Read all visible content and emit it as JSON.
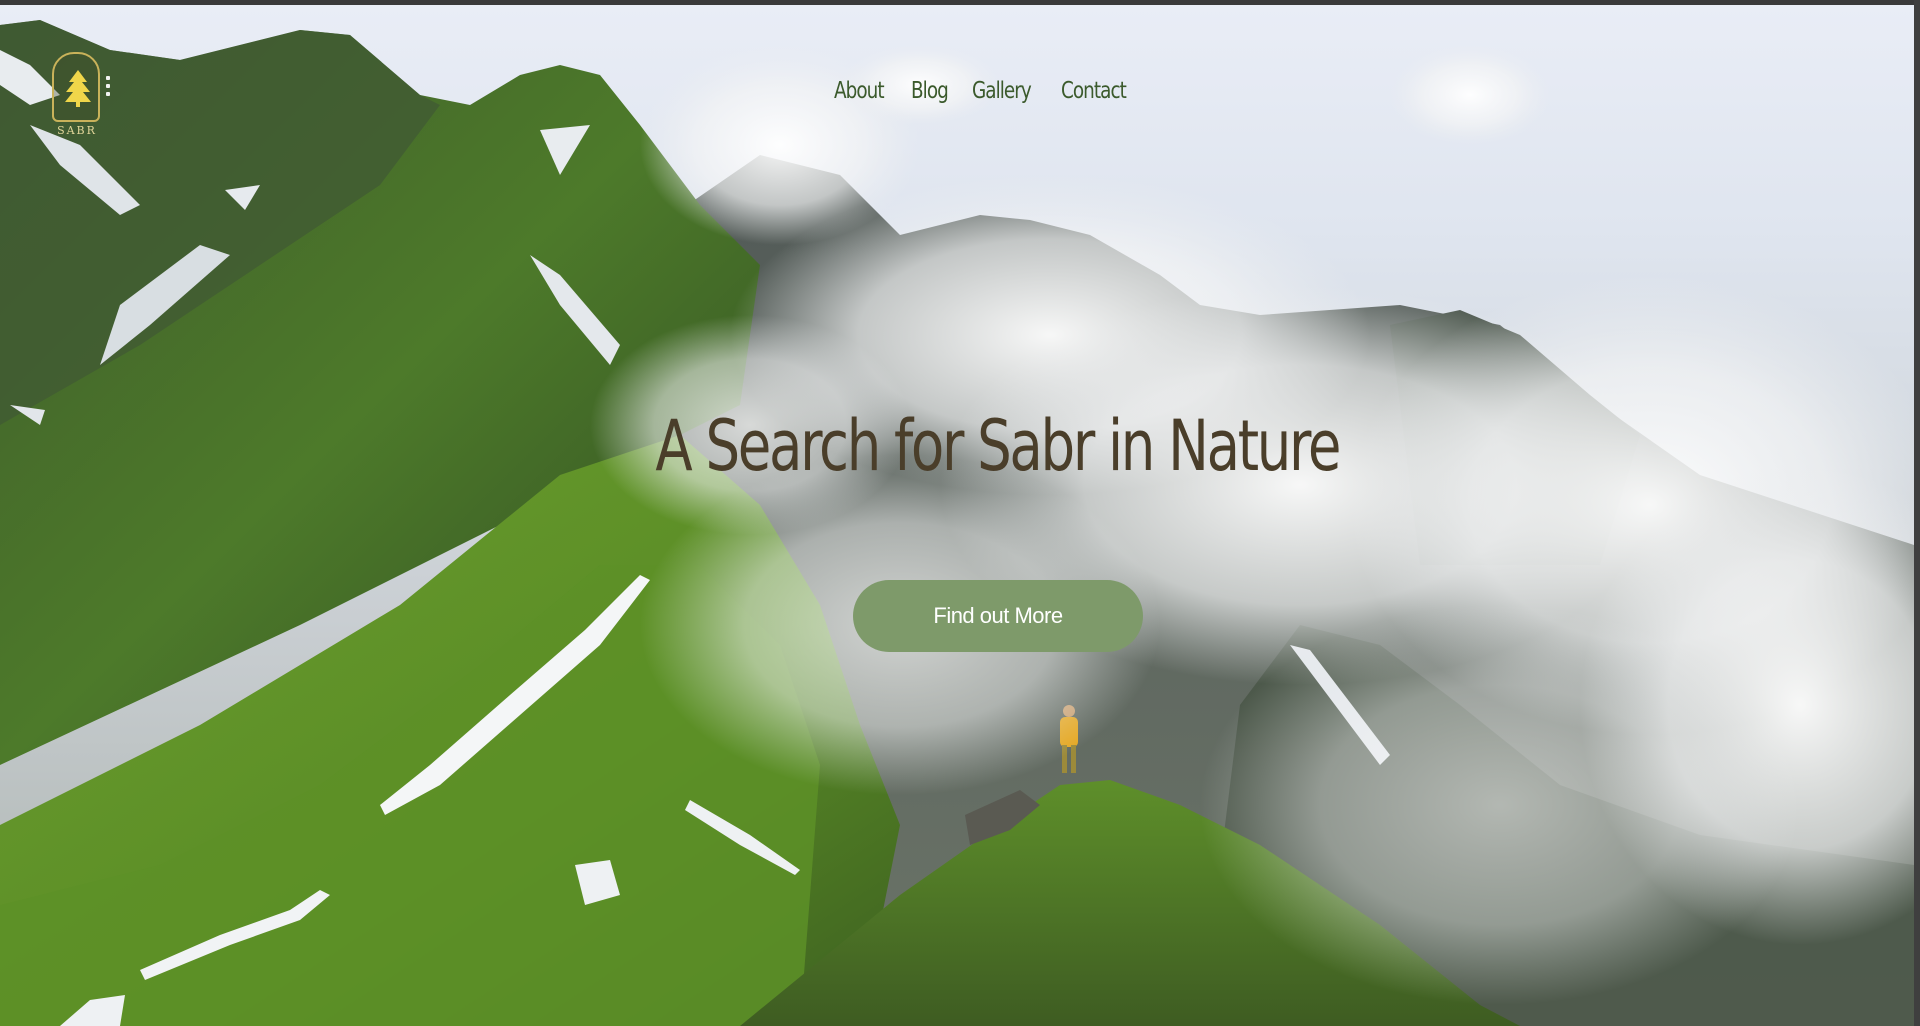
{
  "header": {
    "logo_text": "SABR",
    "nav": [
      {
        "label": "About"
      },
      {
        "label": "Blog"
      },
      {
        "label": "Gallery"
      },
      {
        "label": "Contact"
      }
    ]
  },
  "hero": {
    "title": "A Search for Sabr in Nature",
    "cta_label": "Find out More",
    "image_description_icon": "mountain-landscape-image"
  },
  "colors": {
    "nav_text": "#3b5a2c",
    "title_text": "#4a3e2a",
    "cta_background": "#7e9a6a",
    "cta_text": "#ffffff",
    "logo_gold": "#c9b25a"
  }
}
